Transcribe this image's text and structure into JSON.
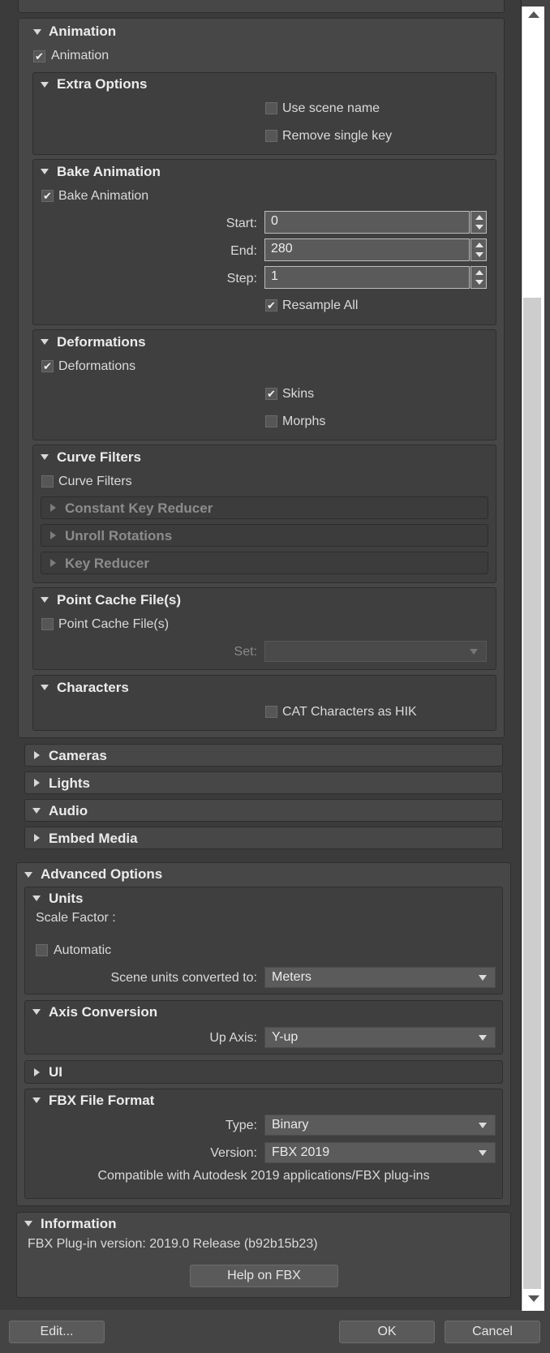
{
  "animation": {
    "header": "Animation",
    "checkbox_label": "Animation",
    "checked": true,
    "extra_options": {
      "header": "Extra Options",
      "use_scene_name": "Use scene name",
      "remove_single_key": "Remove single key"
    },
    "bake_animation": {
      "header": "Bake Animation",
      "checkbox_label": "Bake Animation",
      "start_label": "Start:",
      "start_value": "0",
      "end_label": "End:",
      "end_value": "280",
      "step_label": "Step:",
      "step_value": "1",
      "resample_all": "Resample All"
    },
    "deformations": {
      "header": "Deformations",
      "checkbox_label": "Deformations",
      "skins": "Skins",
      "morphs": "Morphs"
    },
    "curve_filters": {
      "header": "Curve Filters",
      "checkbox_label": "Curve Filters",
      "constant_key_reducer": "Constant Key Reducer",
      "unroll_rotations": "Unroll Rotations",
      "key_reducer": "Key Reducer"
    },
    "point_cache": {
      "header": "Point Cache File(s)",
      "checkbox_label": "Point Cache File(s)",
      "set_label": "Set:"
    },
    "characters": {
      "header": "Characters",
      "cat_as_hik": "CAT Characters as HIK"
    }
  },
  "collapsed_sections": {
    "cameras": "Cameras",
    "lights": "Lights",
    "audio": "Audio",
    "embed_media": "Embed Media"
  },
  "advanced": {
    "header": "Advanced Options",
    "units": {
      "header": "Units",
      "scale_factor": "Scale Factor :",
      "automatic": "Automatic",
      "converted_label": "Scene units converted to:",
      "converted_value": "Meters"
    },
    "axis": {
      "header": "Axis Conversion",
      "up_axis_label": "Up Axis:",
      "up_axis_value": "Y-up"
    },
    "ui": {
      "header": "UI"
    },
    "fbx_format": {
      "header": "FBX File Format",
      "type_label": "Type:",
      "type_value": "Binary",
      "version_label": "Version:",
      "version_value": "FBX 2019",
      "compat_text": "Compatible with Autodesk 2019 applications/FBX plug-ins"
    }
  },
  "information": {
    "header": "Information",
    "version_text": "FBX Plug-in version: 2019.0 Release (b92b15b23)",
    "help_button": "Help on FBX"
  },
  "footer": {
    "edit_button": "Edit...",
    "ok_button": "OK",
    "cancel_button": "Cancel"
  },
  "scrollbar": {
    "thumb_start_fraction": 0.22,
    "thumb_size_fraction": 0.76
  }
}
